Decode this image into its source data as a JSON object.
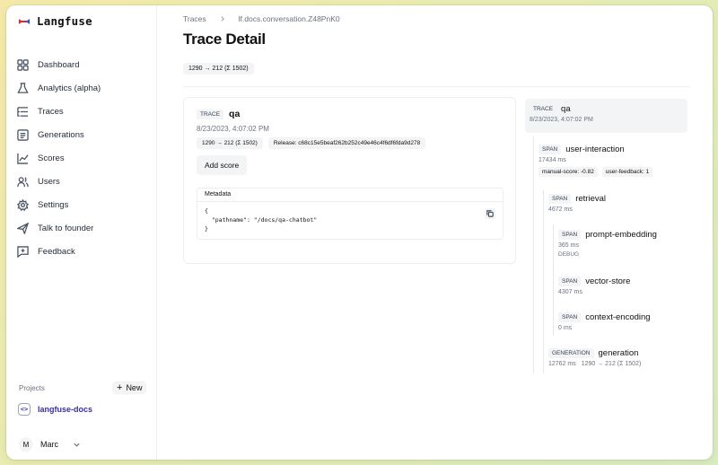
{
  "app": {
    "name": "Langfuse",
    "brand_color": "#d6293e"
  },
  "sidebar": {
    "items": [
      {
        "label": "Dashboard",
        "icon": "grid-icon"
      },
      {
        "label": "Analytics (alpha)",
        "icon": "flask-icon"
      },
      {
        "label": "Traces",
        "icon": "list-tree-icon"
      },
      {
        "label": "Generations",
        "icon": "text-lines-icon"
      },
      {
        "label": "Scores",
        "icon": "line-chart-icon"
      },
      {
        "label": "Users",
        "icon": "users-icon"
      },
      {
        "label": "Settings",
        "icon": "gear-icon"
      },
      {
        "label": "Talk to founder",
        "icon": "send-icon"
      },
      {
        "label": "Feedback",
        "icon": "message-plus-icon"
      }
    ],
    "projects_label": "Projects",
    "new_label": "New",
    "project": "langfuse-docs",
    "user_initial": "M",
    "user_name": "Marc"
  },
  "header": {
    "breadcrumb_root": "Traces",
    "breadcrumb_current": "lf.docs.conversation.Z48PnK0",
    "title": "Trace Detail",
    "usage": "1290 → 212 (Σ 1502)"
  },
  "trace_card": {
    "tag": "TRACE",
    "name": "qa",
    "timestamp": "8/23/2023, 4:07:02 PM",
    "usage": "1290 → 212 (Σ 1502)",
    "release": "Release: c68c15e5beaf262b252c49e46c4f6df6fda9d278",
    "add_score_label": "Add score",
    "metadata_label": "Metadata",
    "metadata_code": "{\n  \"pathname\": \"/docs/qa-chatbot\"\n}"
  },
  "tree": {
    "root": {
      "tag": "TRACE",
      "name": "qa",
      "timestamp": "8/23/2023, 4:07:02 PM"
    },
    "nodes": [
      {
        "tag": "SPAN",
        "name": "user-interaction",
        "meta": "17434 ms",
        "scores": [
          "manual-score: -0.82",
          "user-feedback: 1"
        ]
      },
      {
        "tag": "SPAN",
        "name": "retrieval",
        "meta": "4672 ms"
      },
      {
        "tag": "SPAN",
        "name": "prompt-embedding",
        "meta": "365 ms",
        "level": "DEBUG"
      },
      {
        "tag": "SPAN",
        "name": "vector-store",
        "meta": "4307 ms"
      },
      {
        "tag": "SPAN",
        "name": "context-encoding",
        "meta": "0 ms"
      },
      {
        "tag": "GENERATION",
        "name": "generation",
        "meta": "12762 ms",
        "usage": "1290 → 212 (Σ 1502)"
      }
    ]
  }
}
